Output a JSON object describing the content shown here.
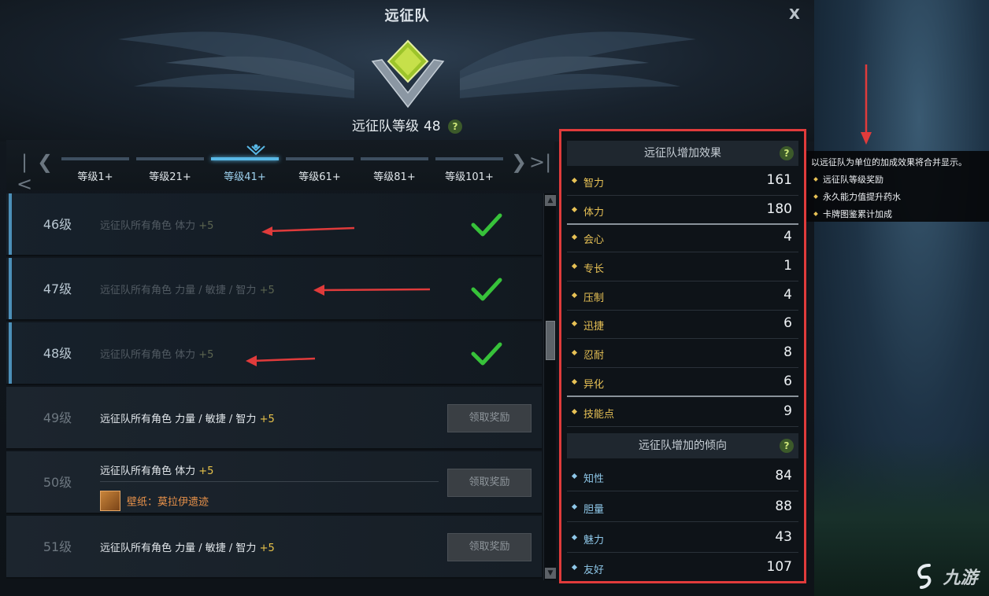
{
  "window": {
    "title": "远征队",
    "close_label": "X",
    "level_label": "远征队等级",
    "level_value": "48",
    "help_label": "?"
  },
  "tabs": [
    {
      "label": "等级1+",
      "active": false
    },
    {
      "label": "等级21+",
      "active": false
    },
    {
      "label": "等级41+",
      "active": true
    },
    {
      "label": "等级61+",
      "active": false
    },
    {
      "label": "等级81+",
      "active": false
    },
    {
      "label": "等级101+",
      "active": false
    }
  ],
  "nav": {
    "first": "K",
    "prev": "❮",
    "next": "❯",
    "last": "K"
  },
  "rewards": [
    {
      "level": "46级",
      "text": "远征队所有角色 体力",
      "bonus": "+5",
      "claimed": true
    },
    {
      "level": "47级",
      "text": "远征队所有角色 力量 / 敏捷 / 智力",
      "bonus": "+5",
      "claimed": true
    },
    {
      "level": "48级",
      "text": "远征队所有角色 体力",
      "bonus": "+5",
      "claimed": true
    },
    {
      "level": "49级",
      "text": "远征队所有角色 力量 / 敏捷 / 智力",
      "bonus": "+5",
      "claimed": false,
      "button": "领取奖励"
    },
    {
      "level": "50级",
      "text": "远征队所有角色 体力",
      "bonus": "+5",
      "claimed": false,
      "button": "领取奖励",
      "extra": "壁纸：莫拉伊遗迹"
    },
    {
      "level": "51级",
      "text": "远征队所有角色 力量 / 敏捷 / 智力",
      "bonus": "+5",
      "claimed": false,
      "button": "领取奖励"
    }
  ],
  "stats_panel": {
    "effects_title": "远征队增加效果",
    "effects": [
      {
        "name": "智力",
        "value": "161"
      },
      {
        "name": "体力",
        "value": "180"
      },
      {
        "name": "会心",
        "value": "4"
      },
      {
        "name": "专长",
        "value": "1"
      },
      {
        "name": "压制",
        "value": "4"
      },
      {
        "name": "迅捷",
        "value": "6"
      },
      {
        "name": "忍耐",
        "value": "8"
      },
      {
        "name": "异化",
        "value": "6"
      },
      {
        "name": "技能点",
        "value": "9"
      }
    ],
    "tendency_title": "远征队增加的倾向",
    "tendencies": [
      {
        "name": "知性",
        "value": "84"
      },
      {
        "name": "胆量",
        "value": "88"
      },
      {
        "name": "魅力",
        "value": "43"
      },
      {
        "name": "友好",
        "value": "107"
      }
    ]
  },
  "tooltip": {
    "title": "以远征队为单位的加成效果将合并显示。",
    "items": [
      "远征队等级奖励",
      "永久能力值提升药水",
      "卡牌图鉴累计加成"
    ]
  },
  "watermark": {
    "text": "九游"
  },
  "colors": {
    "accent_blue": "#59b8e6",
    "bonus_gold": "#e8c34a",
    "highlight_red": "#e03b3b",
    "check_green": "#37c23a",
    "wallpaper_orange": "#e9924a"
  }
}
